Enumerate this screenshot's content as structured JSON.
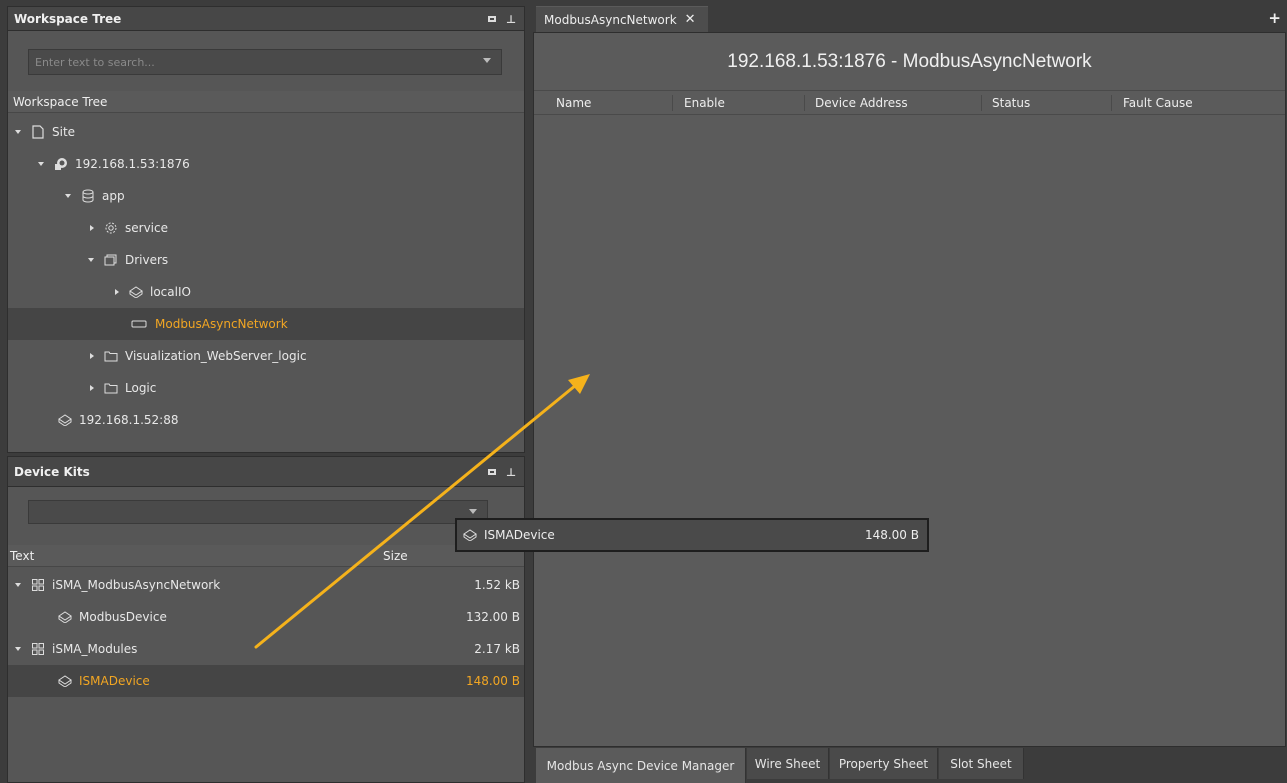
{
  "workspace_panel": {
    "title": "Workspace Tree",
    "search_placeholder": "Enter text to search...",
    "column_header": "Workspace Tree",
    "items": [
      {
        "label": "Site",
        "icon": "file-icon"
      },
      {
        "label": "192.168.1.53:1876",
        "icon": "station-icon"
      },
      {
        "label": "app",
        "icon": "database-icon"
      },
      {
        "label": "service",
        "icon": "gear-icon"
      },
      {
        "label": "Drivers",
        "icon": "drivers-icon"
      },
      {
        "label": "localIO",
        "icon": "device-icon"
      },
      {
        "label": "ModbusAsyncNetwork",
        "icon": "network-icon"
      },
      {
        "label": "Visualization_WebServer_logic",
        "icon": "folder-icon"
      },
      {
        "label": "Logic",
        "icon": "folder-icon"
      },
      {
        "label": "192.168.1.52:88",
        "icon": "device-icon"
      }
    ]
  },
  "device_kits_panel": {
    "title": "Device Kits",
    "columns": {
      "text": "Text",
      "size": "Size"
    },
    "items": [
      {
        "label": "iSMA_ModbusAsyncNetwork",
        "size": "1.52 kB",
        "icon": "kit-icon"
      },
      {
        "label": "ModbusDevice",
        "size": "132.00 B",
        "icon": "device-icon"
      },
      {
        "label": "iSMA_Modules",
        "size": "2.17 kB",
        "icon": "kit-icon"
      },
      {
        "label": "ISMADevice",
        "size": "148.00 B",
        "icon": "device-icon"
      }
    ]
  },
  "editor": {
    "tab_label": "ModbusAsyncNetwork",
    "tab_close": "✕",
    "add_tab": "+",
    "title": "192.168.1.53:1876 - ModbusAsyncNetwork",
    "columns": [
      "Name",
      "Enable",
      "Device Address",
      "Status",
      "Fault Cause"
    ]
  },
  "bottom_tabs": [
    "Modbus Async Device Manager",
    "Wire Sheet",
    "Property Sheet",
    "Slot Sheet"
  ],
  "drag_ghost": {
    "label": "ISMADevice",
    "size": "148.00 B"
  },
  "colors": {
    "accent": "#f2a623",
    "arrow": "#f5b21b"
  }
}
